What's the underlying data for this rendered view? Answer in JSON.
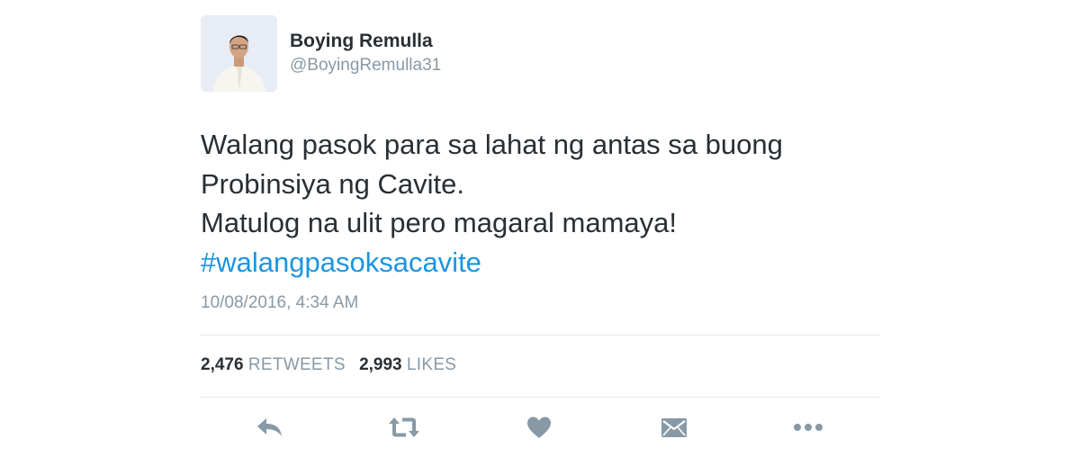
{
  "user": {
    "display_name": "Boying Remulla",
    "handle": "@BoyingRemulla31"
  },
  "tweet": {
    "lines": [
      "Walang pasok para sa lahat ng antas sa buong",
      "Probinsiya ng Cavite.",
      "Matulog na ulit pero magaral mamaya!"
    ],
    "hashtag": "#walangpasoksacavite",
    "timestamp": "10/08/2016, 4:34 AM"
  },
  "stats": {
    "retweets_count": "2,476",
    "retweets_label": "RETWEETS",
    "likes_count": "2,993",
    "likes_label": "LIKES"
  },
  "actions": [
    {
      "name": "reply",
      "icon": "reply-icon"
    },
    {
      "name": "retweet",
      "icon": "retweet-icon"
    },
    {
      "name": "like",
      "icon": "heart-icon"
    },
    {
      "name": "direct-message",
      "icon": "envelope-icon"
    },
    {
      "name": "more",
      "icon": "more-icon"
    }
  ],
  "colors": {
    "text": "#292f33",
    "secondary": "#8899a6",
    "link": "#1b95e0",
    "icon": "#8899a6",
    "divider": "#e1e8ed"
  }
}
